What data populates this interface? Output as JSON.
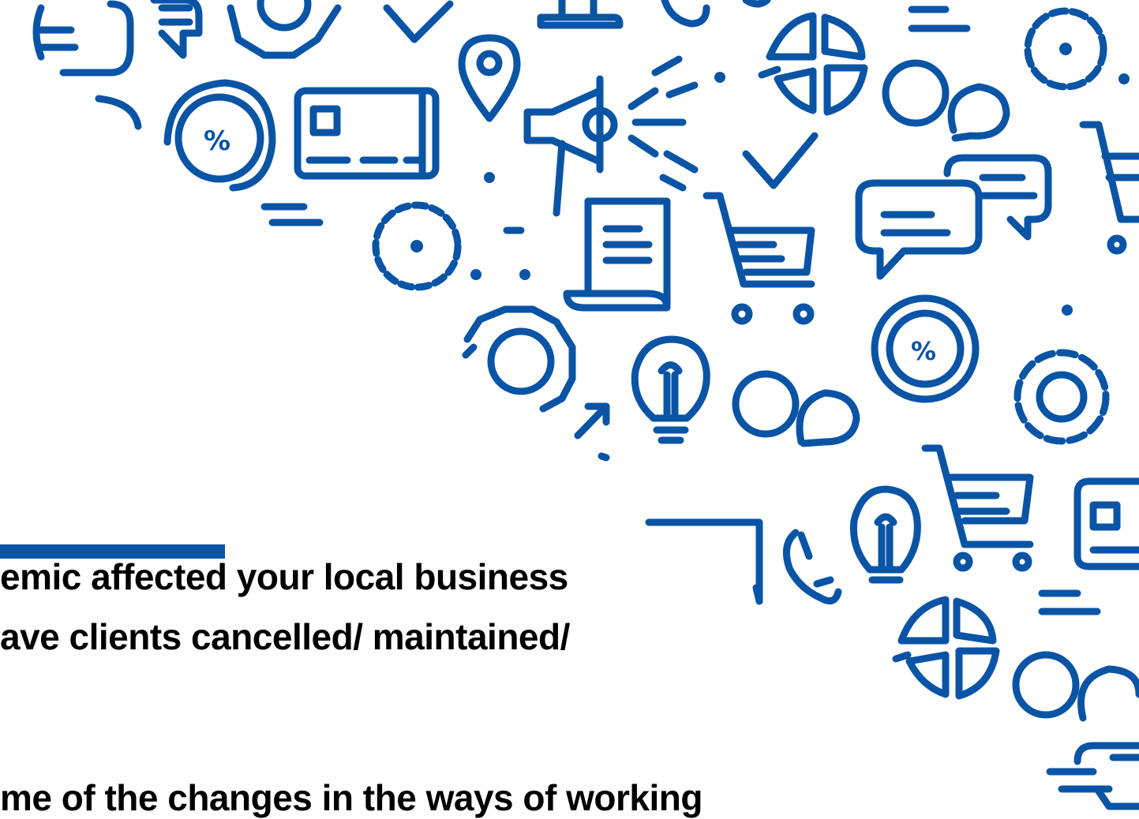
{
  "colors": {
    "accent": "#0a54a6",
    "text": "#000000",
    "background": "#ffffff"
  },
  "slide": {
    "question_line_1": "emic affected your local business",
    "question_line_2": "ave clients cancelled/ maintained/",
    "question_line_3": "me of the changes in the ways of working"
  },
  "icons": {
    "percent_symbol": "%",
    "list": [
      "chat-bubbles-icon",
      "gear-icon",
      "checkmark-icon",
      "map-pin-icon",
      "megaphone-icon",
      "percent-ring-icon",
      "credit-card-icon",
      "document-icon",
      "shopping-cart-icon",
      "lightbulb-icon",
      "pie-chart-icon",
      "phone-icon",
      "speech-bubbles-icon",
      "arrow-up-right-icon"
    ]
  }
}
